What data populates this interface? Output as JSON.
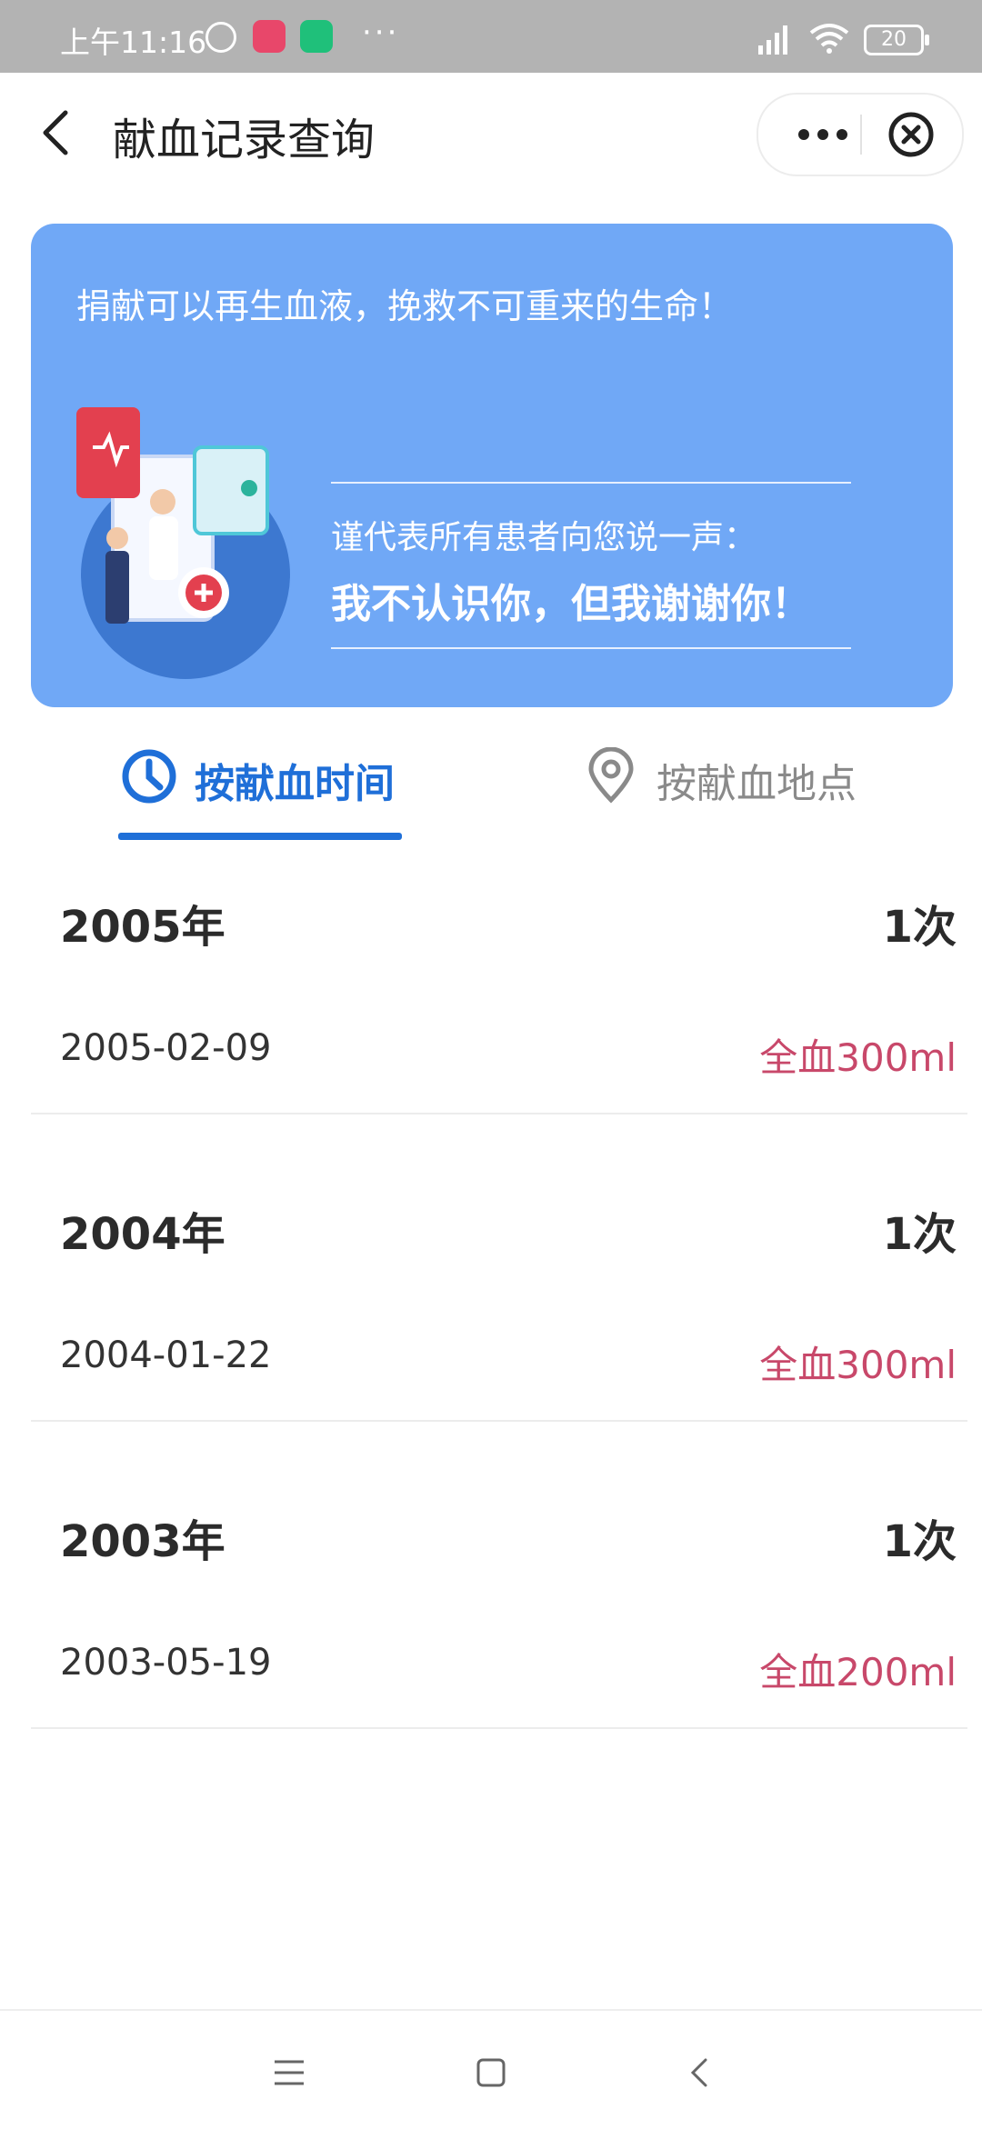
{
  "status_bar": {
    "time": "上午11:16",
    "battery": "20",
    "dots": "···"
  },
  "header": {
    "title": "献血记录查询"
  },
  "banner": {
    "slogan": "捐献可以再生血液，挽救不可重来的生命！",
    "message_line1": "谨代表所有患者向您说一声：",
    "message_line2": "我不认识你，但我谢谢你！"
  },
  "tabs": [
    {
      "label": "按献血时间",
      "icon": "clock-icon",
      "active": true
    },
    {
      "label": "按献血地点",
      "icon": "location-pin-icon",
      "active": false
    }
  ],
  "records": [
    {
      "year": "2005年",
      "count": "1次",
      "date": "2005-02-09",
      "amount": "全血300ml"
    },
    {
      "year": "2004年",
      "count": "1次",
      "date": "2004-01-22",
      "amount": "全血300ml"
    },
    {
      "year": "2003年",
      "count": "1次",
      "date": "2003-05-19",
      "amount": "全血200ml"
    }
  ],
  "colors": {
    "accent": "#1f6fd8",
    "banner": "#70a8f6",
    "amount": "#c8486a",
    "status_bar": "#b3b3b3"
  }
}
